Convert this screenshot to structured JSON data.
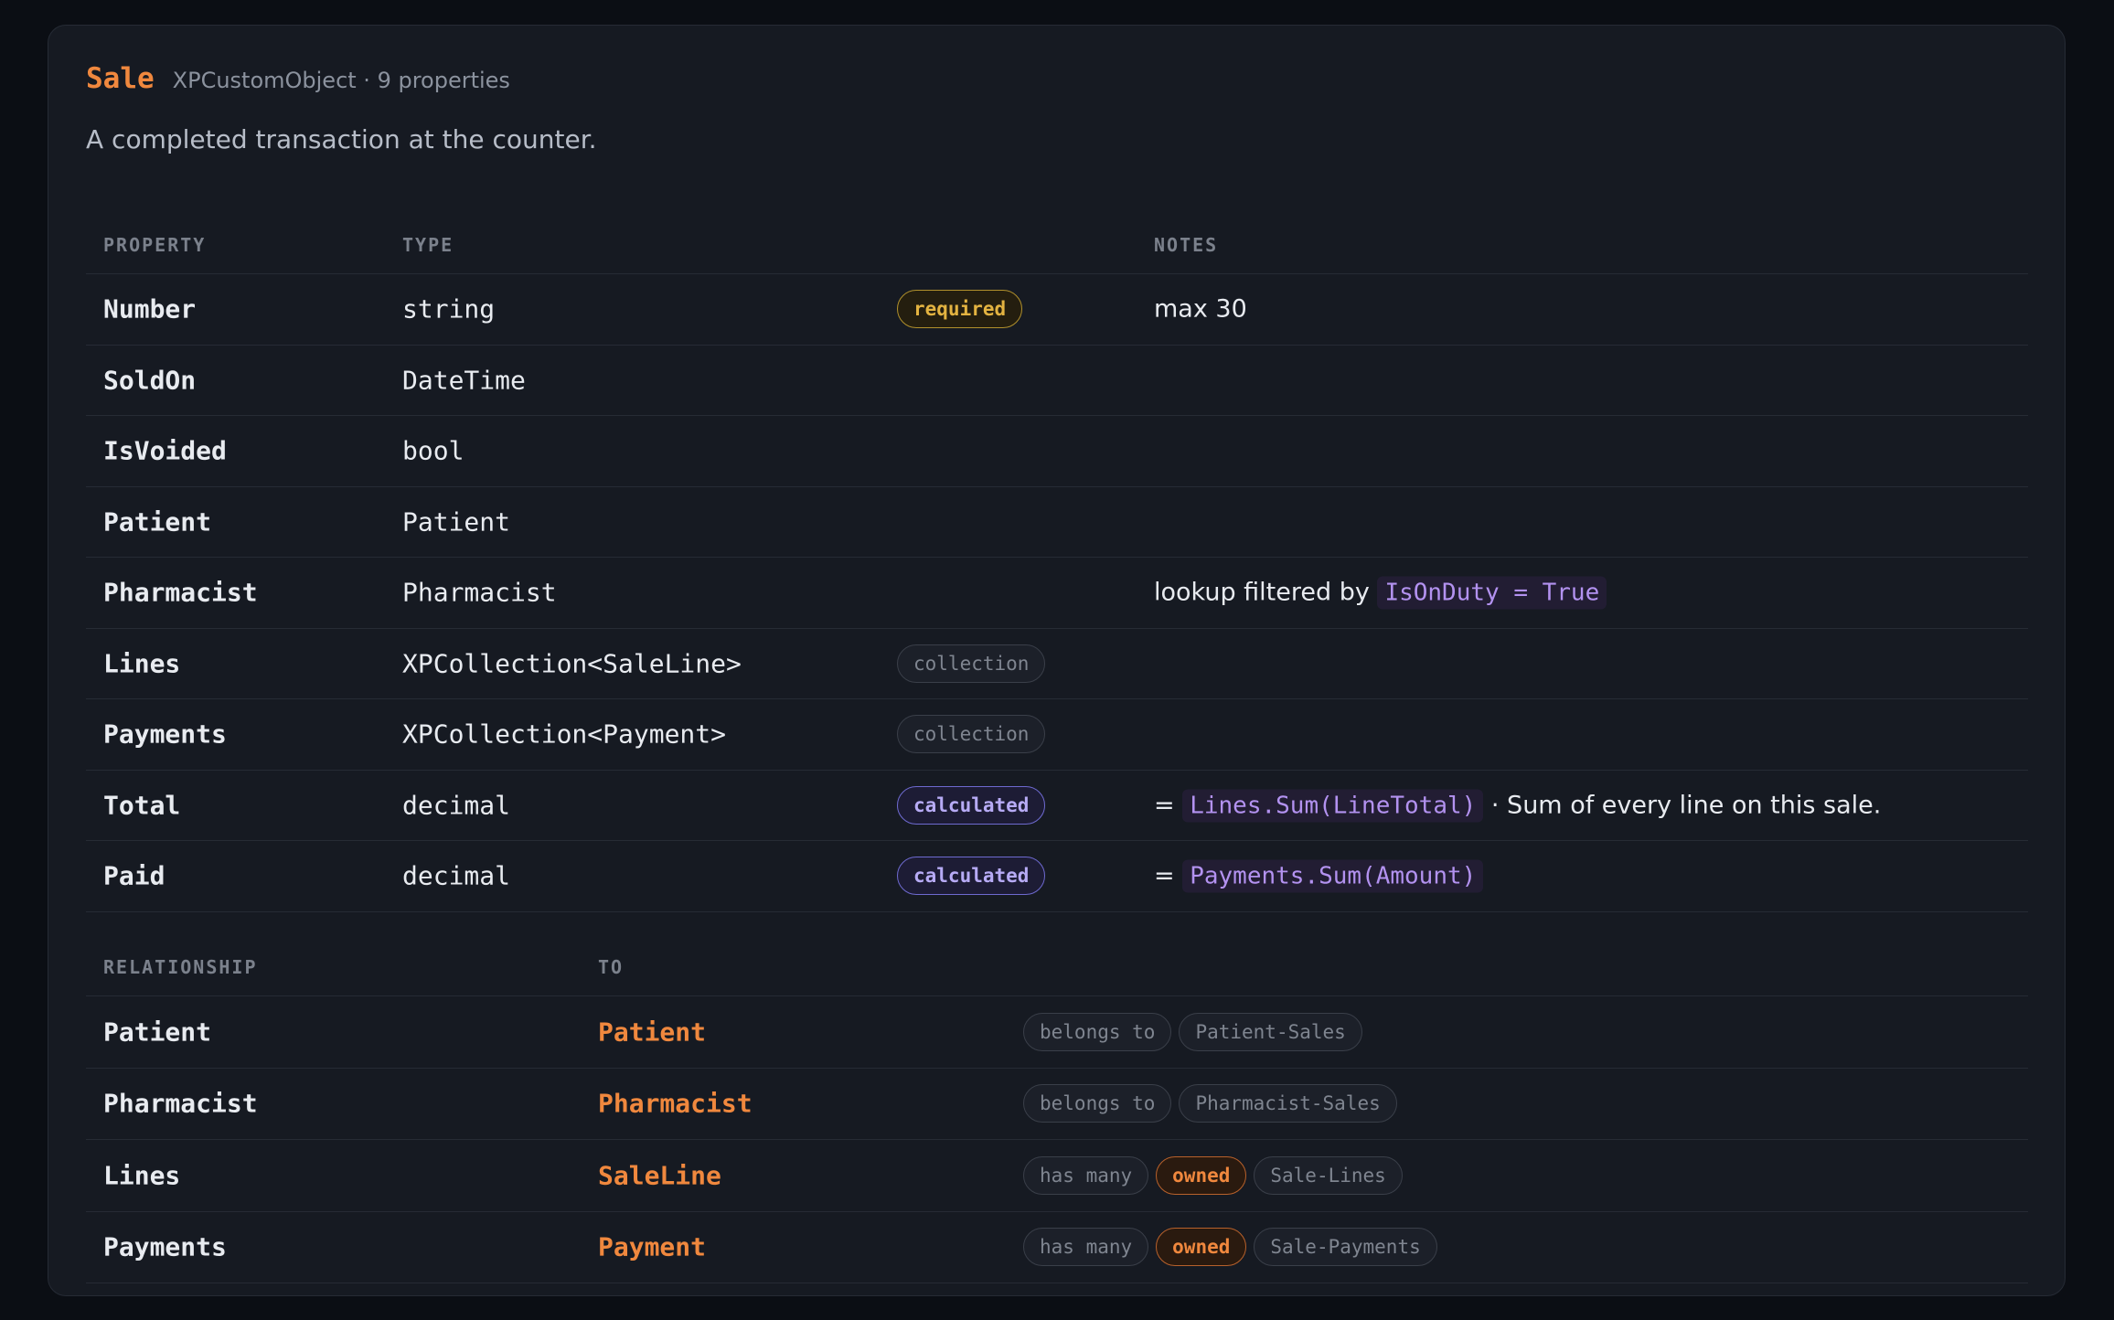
{
  "entity": {
    "name": "Sale",
    "meta": "XPCustomObject · 9 properties",
    "description": "A completed transaction at the counter."
  },
  "properties": {
    "headers": {
      "property": "PROPERTY",
      "type": "TYPE",
      "notes": "NOTES"
    },
    "rows": [
      {
        "name": "Number",
        "type": "string",
        "badge": "required",
        "note": "max 30"
      },
      {
        "name": "SoldOn",
        "type": "DateTime"
      },
      {
        "name": "IsVoided",
        "type": "bool"
      },
      {
        "name": "Patient",
        "type": "Patient"
      },
      {
        "name": "Pharmacist",
        "type": "Pharmacist",
        "note_prefix": "lookup filtered by",
        "note_code": "IsOnDuty = True"
      },
      {
        "name": "Lines",
        "type": "XPCollection<SaleLine>",
        "badge": "collection"
      },
      {
        "name": "Payments",
        "type": "XPCollection<Payment>",
        "badge": "collection"
      },
      {
        "name": "Total",
        "type": "decimal",
        "badge": "calculated",
        "note_eq": "=",
        "note_code": "Lines.Sum(LineTotal)",
        "note_suffix": "· Sum of every line on this sale."
      },
      {
        "name": "Paid",
        "type": "decimal",
        "badge": "calculated",
        "note_eq": "=",
        "note_code": "Payments.Sum(Amount)"
      }
    ]
  },
  "relationships": {
    "headers": {
      "relationship": "RELATIONSHIP",
      "to": "TO"
    },
    "rows": [
      {
        "name": "Patient",
        "to": "Patient",
        "kind": "belongs to",
        "association": "Patient-Sales"
      },
      {
        "name": "Pharmacist",
        "to": "Pharmacist",
        "kind": "belongs to",
        "association": "Pharmacist-Sales"
      },
      {
        "name": "Lines",
        "to": "SaleLine",
        "kind": "has many",
        "owned": "owned",
        "association": "Sale-Lines"
      },
      {
        "name": "Payments",
        "to": "Payment",
        "kind": "has many",
        "owned": "owned",
        "association": "Sale-Payments"
      }
    ]
  },
  "colors": {
    "accent": "#f0883e",
    "code": "#b392f0",
    "required": "#e3b341",
    "background": "#161a22"
  }
}
